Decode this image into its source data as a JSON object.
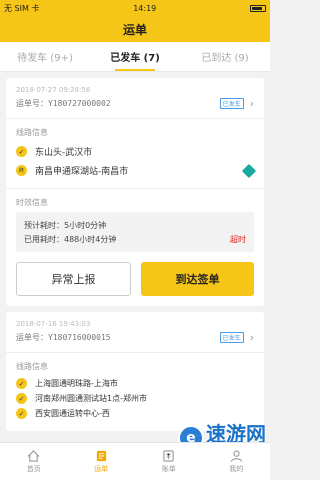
{
  "statusbar": {
    "carrier": "无 SIM 卡",
    "time": "14:19",
    "battery": "令"
  },
  "navbar": {
    "title": "运单"
  },
  "tabs": [
    {
      "label": "待发车 (9+)",
      "active": false
    },
    {
      "label": "已发车 (7)",
      "active": true
    },
    {
      "label": "已到达 (9)",
      "active": false
    }
  ],
  "card1": {
    "date": "2018-07-27 09:28:56",
    "order_label": "运单号：",
    "order_no": "Y180727000002",
    "status_badge": "已发车",
    "route_label": "线路信息",
    "route": [
      {
        "marker": "✓",
        "name": "东山头-武汉市"
      },
      {
        "marker": "终",
        "name": "南昌申通琛湖站-南昌市"
      }
    ],
    "time_label": "时效信息",
    "expected_label": "预计耗时：",
    "expected_value": "5小时0分钟",
    "used_label": "已用耗时：",
    "used_value": "488小时4分钟",
    "overtime": "超时",
    "btn_exception": "异常上报",
    "btn_arrive": "到达签单"
  },
  "card2": {
    "date": "2018-07-16 19:43:03",
    "order_label": "运单号：",
    "order_no": "Y180716000015",
    "status_badge": "已发车",
    "route_label": "线路信息",
    "route": [
      {
        "marker": "✓",
        "name": "上海圆通明珠路-上海市"
      },
      {
        "marker": "✓",
        "name": "河南郑州圆通测试站1点-郑州市"
      },
      {
        "marker": "✓",
        "name": "西安圆通运转中心-西"
      }
    ]
  },
  "bottombar": [
    {
      "label": "首页",
      "icon": "home-icon",
      "active": false
    },
    {
      "label": "运单",
      "icon": "waybill-icon",
      "active": true
    },
    {
      "label": "账单",
      "icon": "bill-icon",
      "active": false
    },
    {
      "label": "我的",
      "icon": "profile-icon",
      "active": false
    }
  ],
  "watermark": {
    "title": "速游网",
    "url": "www.66ssg.com"
  },
  "colors": {
    "accent": "#f5c518",
    "overtime": "#e2221d",
    "badge": "#4a9be8"
  }
}
